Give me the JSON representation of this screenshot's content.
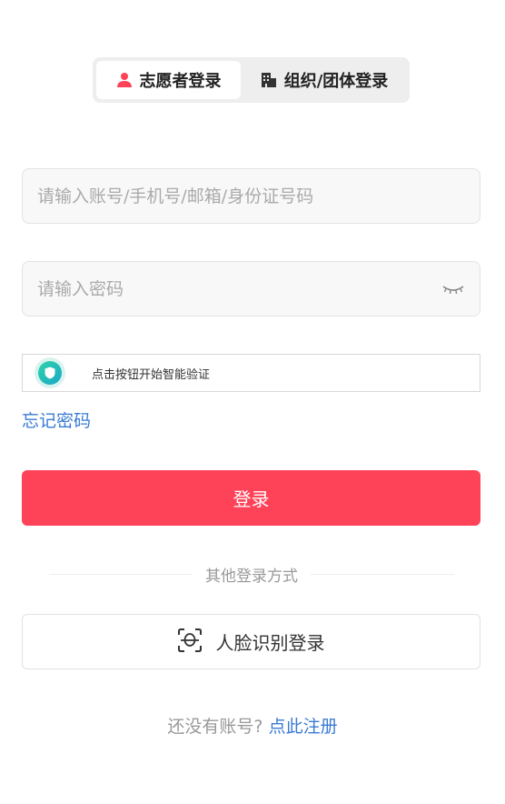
{
  "tabs": {
    "volunteer_label": "志愿者登录",
    "org_label": "组织/团体登录"
  },
  "account": {
    "placeholder": "请输入账号/手机号/邮箱/身份证号码"
  },
  "password": {
    "placeholder": "请输入密码"
  },
  "captcha": {
    "label": "点击按钮开始智能验证"
  },
  "forgot_label": "忘记密码",
  "login_label": "登录",
  "other_methods_label": "其他登录方式",
  "face_login_label": "人脸识别登录",
  "register": {
    "prompt": "还没有账号?",
    "link_label": "点此注册"
  },
  "colors": {
    "accent": "#fe4359",
    "link": "#3a7bd5"
  },
  "icons": [
    "person-icon",
    "building-icon",
    "eye-closed-icon",
    "shield-icon",
    "face-scan-icon"
  ]
}
